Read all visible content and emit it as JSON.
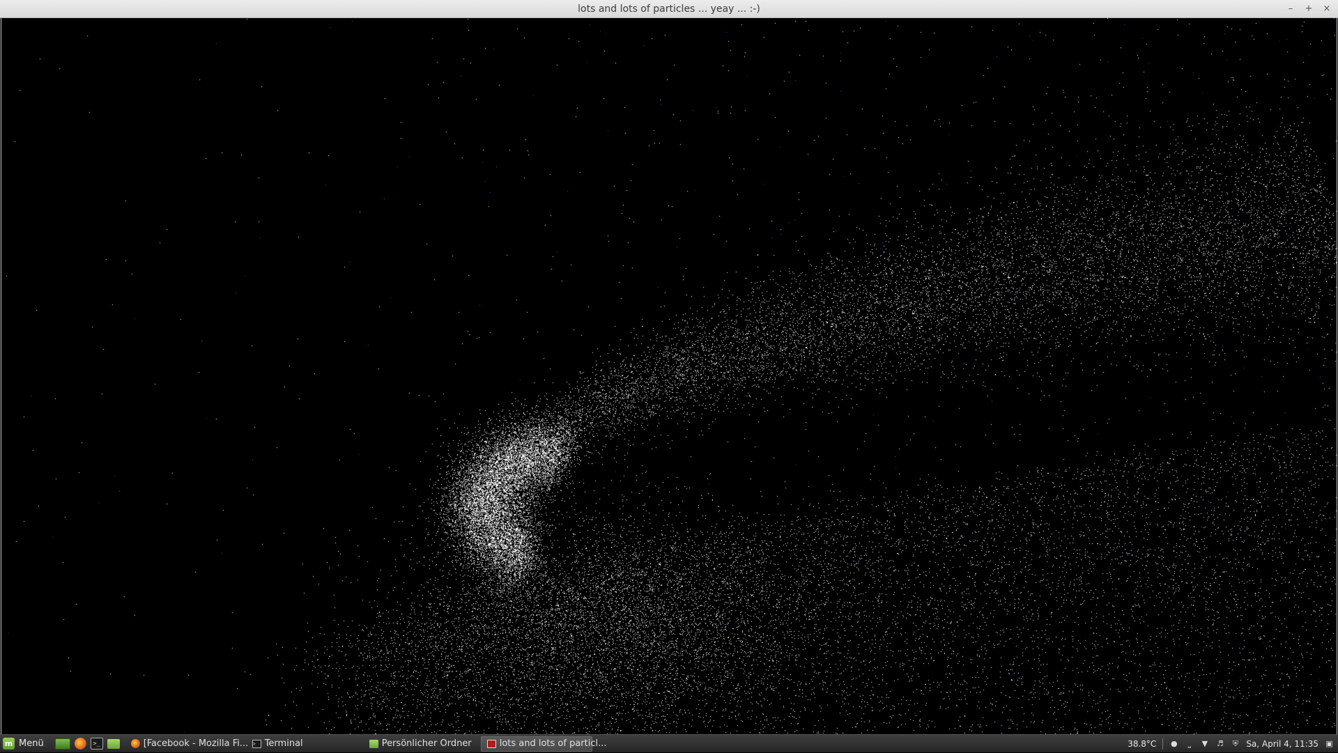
{
  "window": {
    "title": "lots and lots of particles ... yeay ... :-)",
    "controls": {
      "minimize": "–",
      "maximize": "+",
      "close": "×"
    }
  },
  "scene": {
    "background": "#000000",
    "colors": {
      "hot_core": "#e8542a",
      "mid_band": "#b07ab0",
      "cool_band": "#5577cc",
      "outer_glow": "#3b57a6"
    }
  },
  "taskbar": {
    "menu_label": "Menü",
    "launchers": [
      {
        "name": "show-desktop-icon"
      },
      {
        "name": "firefox-icon"
      },
      {
        "name": "terminal-icon"
      },
      {
        "name": "files-icon"
      }
    ],
    "tasks": [
      {
        "label": "[Facebook - Mozilla Fi...",
        "icon": "firefox-icon",
        "active": false
      },
      {
        "label": "Terminal",
        "icon": "terminal-icon",
        "active": false
      },
      {
        "label": "Persönlicher Ordner",
        "icon": "folder-icon",
        "active": false
      },
      {
        "label": "lots and lots of particl...",
        "icon": "particles-app-icon",
        "active": true
      }
    ],
    "tray": {
      "temperature": "38.8°C",
      "clock": "Sa, April  4, 11:35"
    }
  }
}
